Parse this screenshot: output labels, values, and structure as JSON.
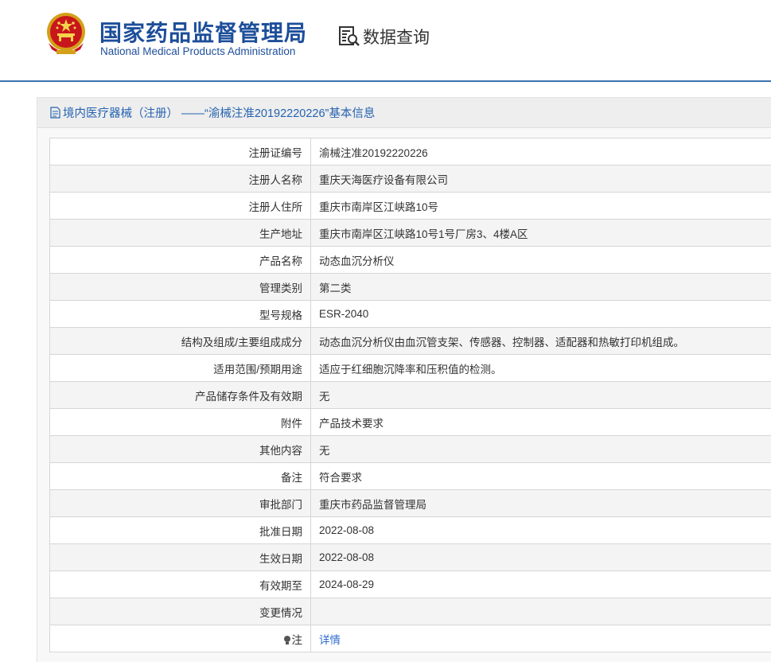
{
  "header": {
    "org_name_cn": "国家药品监督管理局",
    "org_name_en": "National Medical Products Administration",
    "nav_label": "数据查询",
    "accent_color": "#1d4e9a",
    "line_color": "#3a72b0"
  },
  "panel": {
    "title": "境内医疗器械（注册） ——“渝械注准20192220226”基本信息"
  },
  "rows": [
    {
      "label": "注册证编号",
      "value": "渝械注准20192220226"
    },
    {
      "label": "注册人名称",
      "value": "重庆天海医疗设备有限公司"
    },
    {
      "label": "注册人住所",
      "value": "重庆市南岸区江峡路10号"
    },
    {
      "label": "生产地址",
      "value": "重庆市南岸区江峡路10号1号厂房3、4楼A区"
    },
    {
      "label": "产品名称",
      "value": "动态血沉分析仪"
    },
    {
      "label": "管理类别",
      "value": "第二类"
    },
    {
      "label": "型号规格",
      "value": "ESR-2040"
    },
    {
      "label": "结构及组成/主要组成成分",
      "value": "动态血沉分析仪由血沉管支架、传感器、控制器、适配器和热敏打印机组成。"
    },
    {
      "label": "适用范围/预期用途",
      "value": "适应于红细胞沉降率和压积值的检测。"
    },
    {
      "label": "产品储存条件及有效期",
      "value": "无"
    },
    {
      "label": "附件",
      "value": "产品技术要求"
    },
    {
      "label": "其他内容",
      "value": "无"
    },
    {
      "label": "备注",
      "value": "符合要求"
    },
    {
      "label": "审批部门",
      "value": "重庆市药品监督管理局"
    },
    {
      "label": "批准日期",
      "value": "2022-08-08"
    },
    {
      "label": "生效日期",
      "value": "2022-08-08"
    },
    {
      "label": "有效期至",
      "value": "2024-08-29"
    },
    {
      "label": "变更情况",
      "value": ""
    }
  ],
  "note_row": {
    "label": "注",
    "link": "详情",
    "icon": "bulb-icon"
  }
}
